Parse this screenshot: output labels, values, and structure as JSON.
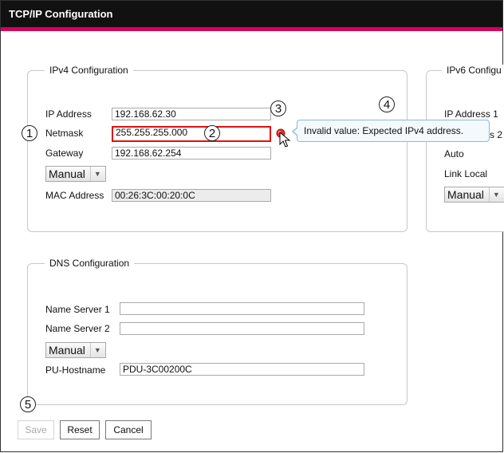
{
  "window": {
    "title": "TCP/IP Configuration"
  },
  "ipv4": {
    "legend": "IPv4 Configuration",
    "ip_label": "IP Address",
    "ip_value": "192.168.62.30",
    "netmask_label": "Netmask",
    "netmask_value": "255.255.255.000",
    "gateway_label": "Gateway",
    "gateway_value": "192.168.62.254",
    "mode": "Manual",
    "mac_label": "MAC Address",
    "mac_value": "00:26:3C:00:20:0C"
  },
  "ipv6": {
    "legend": "IPv6 Configu",
    "ip1_label": "IP Address 1",
    "ip2_label_fragment": "s 2",
    "auto_label": "Auto",
    "link_local_label": "Link Local",
    "mode": "Manual"
  },
  "error_tooltip": {
    "text": "Invalid value: Expected IPv4 address."
  },
  "dns": {
    "legend": "DNS Configuration",
    "ns1_label": "Name Server 1",
    "ns1_value": "",
    "ns2_label": "Name Server 2",
    "ns2_value": "",
    "mode": "Manual",
    "hostname_label": "PU-Hostname",
    "hostname_value": "PDU-3C00200C"
  },
  "buttons": {
    "save": "Save",
    "reset": "Reset",
    "cancel": "Cancel"
  },
  "callouts": [
    "1",
    "2",
    "3",
    "4",
    "5"
  ],
  "colors": {
    "title_bar": "#111111",
    "accent_stripe": "#d9005b",
    "error_border": "#e01010",
    "error_icon": "#e2342a"
  },
  "icons": {
    "error": "error-dot-icon",
    "cursor": "mouse-pointer-icon",
    "dropdown": "chevron-down-icon"
  }
}
